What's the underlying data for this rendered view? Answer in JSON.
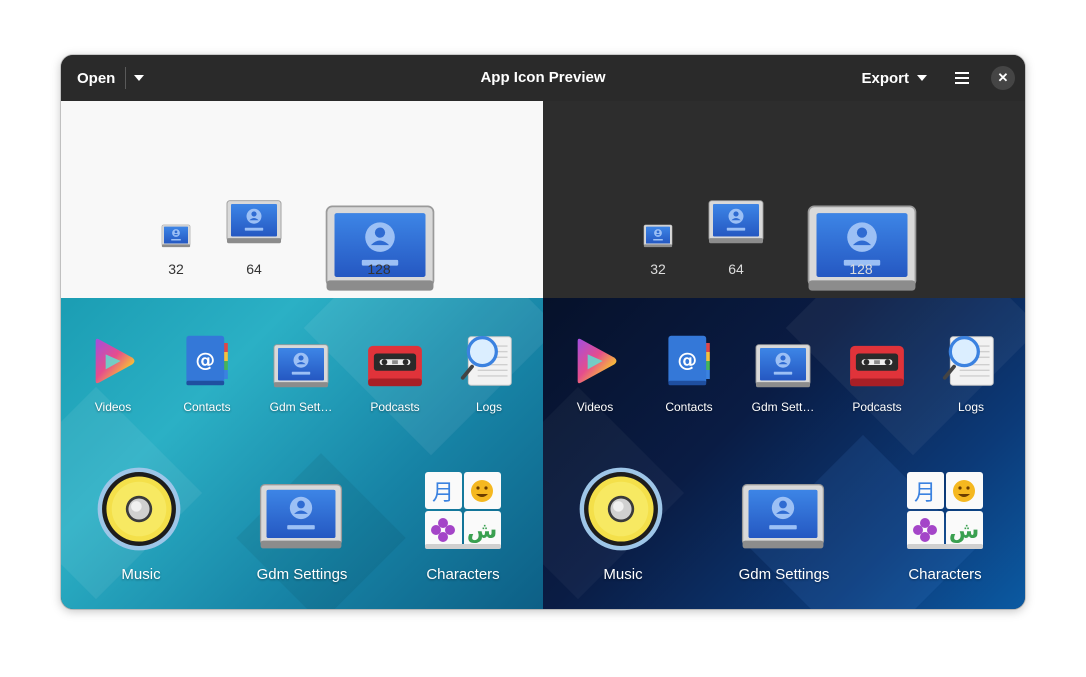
{
  "window": {
    "title": "App Icon Preview",
    "open_label": "Open",
    "export_label": "Export",
    "close_glyph": "✕"
  },
  "sizes": [
    "32",
    "64",
    "128"
  ],
  "small_apps": [
    {
      "label": "Videos",
      "icon": "videos-icon"
    },
    {
      "label": "Contacts",
      "icon": "contacts-icon"
    },
    {
      "label": "Gdm Sett…",
      "icon": "gdm-settings-icon"
    },
    {
      "label": "Podcasts",
      "icon": "podcasts-icon"
    },
    {
      "label": "Logs",
      "icon": "logs-icon"
    }
  ],
  "large_apps": [
    {
      "label": "Music",
      "icon": "music-icon"
    },
    {
      "label": "Gdm Settings",
      "icon": "gdm-settings-icon"
    },
    {
      "label": "Characters",
      "icon": "characters-icon"
    }
  ],
  "characters_glyphs": [
    "月",
    "☺",
    "✤",
    "ش"
  ],
  "colors": {
    "headerbar": "#2a2a2a",
    "light_bg": "#f8f8f8",
    "dark_bg": "#2d2d2d",
    "accent_blue": "#3b82e0"
  }
}
